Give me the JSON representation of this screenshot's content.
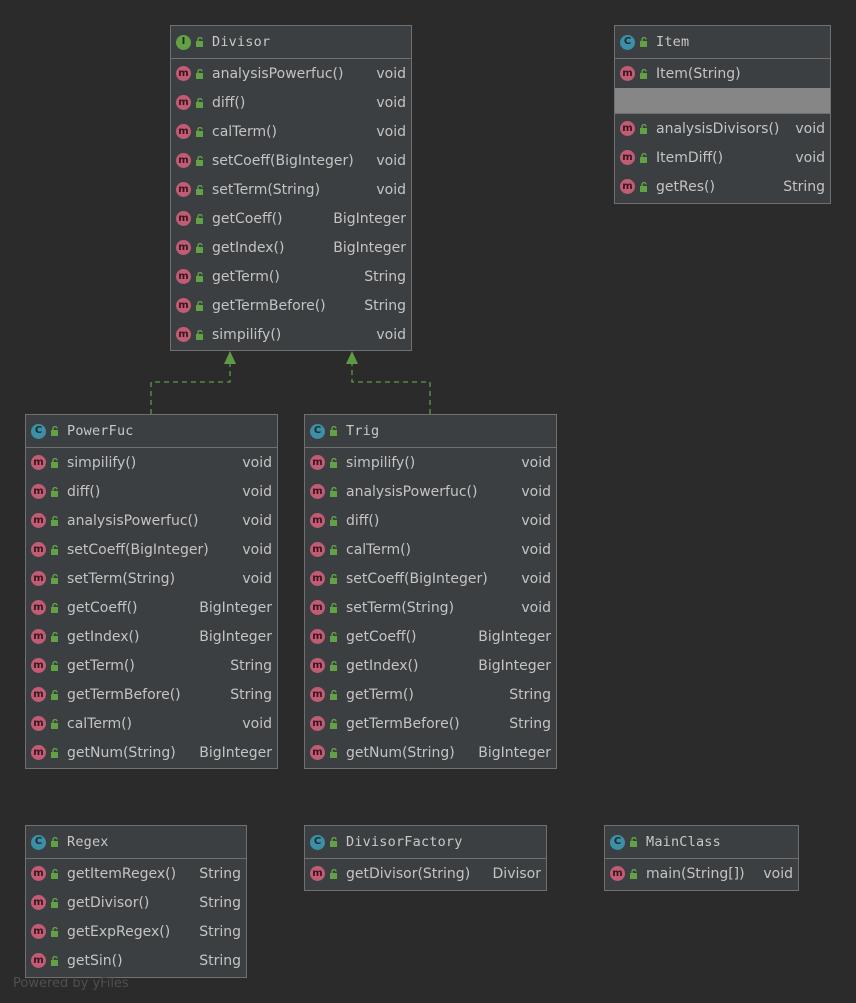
{
  "classes": {
    "divisor": {
      "name": "Divisor",
      "kind": "I",
      "methods": [
        {
          "name": "analysisPowerfuc()",
          "ret": "void"
        },
        {
          "name": "diff()",
          "ret": "void"
        },
        {
          "name": "calTerm()",
          "ret": "void"
        },
        {
          "name": "setCoeff(BigInteger)",
          "ret": "void"
        },
        {
          "name": "setTerm(String)",
          "ret": "void"
        },
        {
          "name": "getCoeff()",
          "ret": "BigInteger"
        },
        {
          "name": "getIndex()",
          "ret": "BigInteger"
        },
        {
          "name": "getTerm()",
          "ret": "String"
        },
        {
          "name": "getTermBefore()",
          "ret": "String"
        },
        {
          "name": "simpilify()",
          "ret": "void"
        }
      ]
    },
    "item": {
      "name": "Item",
      "kind": "C",
      "constructors": [
        {
          "name": "Item(String)",
          "ret": ""
        }
      ],
      "methods": [
        {
          "name": "analysisDivisors()",
          "ret": "void"
        },
        {
          "name": "ItemDiff()",
          "ret": "void"
        },
        {
          "name": "getRes()",
          "ret": "String"
        }
      ]
    },
    "powerfuc": {
      "name": "PowerFuc",
      "kind": "C",
      "methods": [
        {
          "name": "simpilify()",
          "ret": "void"
        },
        {
          "name": "diff()",
          "ret": "void"
        },
        {
          "name": "analysisPowerfuc()",
          "ret": "void"
        },
        {
          "name": "setCoeff(BigInteger)",
          "ret": "void"
        },
        {
          "name": "setTerm(String)",
          "ret": "void"
        },
        {
          "name": "getCoeff()",
          "ret": "BigInteger"
        },
        {
          "name": "getIndex()",
          "ret": "BigInteger"
        },
        {
          "name": "getTerm()",
          "ret": "String"
        },
        {
          "name": "getTermBefore()",
          "ret": "String"
        },
        {
          "name": "calTerm()",
          "ret": "void"
        },
        {
          "name": "getNum(String)",
          "ret": "BigInteger"
        }
      ]
    },
    "trig": {
      "name": "Trig",
      "kind": "C",
      "methods": [
        {
          "name": "simpilify()",
          "ret": "void"
        },
        {
          "name": "analysisPowerfuc()",
          "ret": "void"
        },
        {
          "name": "diff()",
          "ret": "void"
        },
        {
          "name": "calTerm()",
          "ret": "void"
        },
        {
          "name": "setCoeff(BigInteger)",
          "ret": "void"
        },
        {
          "name": "setTerm(String)",
          "ret": "void"
        },
        {
          "name": "getCoeff()",
          "ret": "BigInteger"
        },
        {
          "name": "getIndex()",
          "ret": "BigInteger"
        },
        {
          "name": "getTerm()",
          "ret": "String"
        },
        {
          "name": "getTermBefore()",
          "ret": "String"
        },
        {
          "name": "getNum(String)",
          "ret": "BigInteger"
        }
      ]
    },
    "regex": {
      "name": "Regex",
      "kind": "C",
      "methods": [
        {
          "name": "getItemRegex()",
          "ret": "String"
        },
        {
          "name": "getDivisor()",
          "ret": "String"
        },
        {
          "name": "getExpRegex()",
          "ret": "String"
        },
        {
          "name": "getSin()",
          "ret": "String"
        }
      ]
    },
    "divisorfactory": {
      "name": "DivisorFactory",
      "kind": "C",
      "methods": [
        {
          "name": "getDivisor(String)",
          "ret": "Divisor"
        }
      ]
    },
    "mainclass": {
      "name": "MainClass",
      "kind": "C",
      "methods": [
        {
          "name": "main(String[])",
          "ret": "void"
        }
      ]
    }
  },
  "colors": {
    "background": "#2b2b2b",
    "panel": "#3c3f41",
    "interface_badge": "#62a146",
    "class_badge": "#3b8fa6",
    "method_badge": "#c05c73",
    "edge": "#5f9a45"
  },
  "watermark": "Powered by yFiles"
}
